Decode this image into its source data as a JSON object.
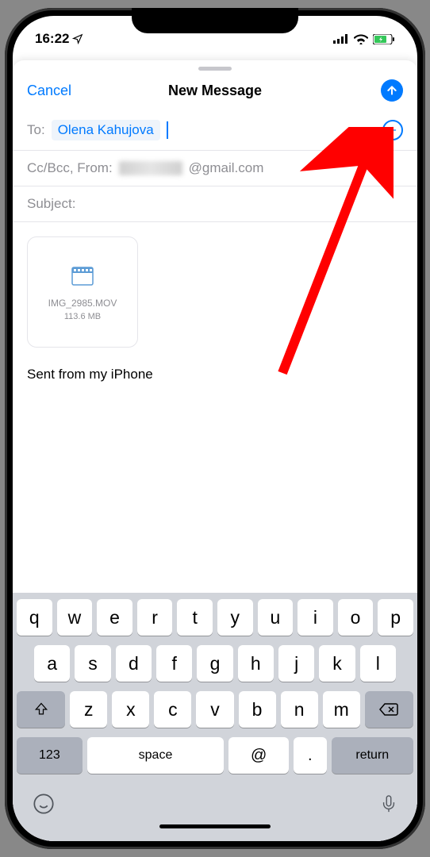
{
  "status": {
    "time": "16:22"
  },
  "nav": {
    "cancel": "Cancel",
    "title": "New Message"
  },
  "to": {
    "label": "To:",
    "recipient": "Olena Kahujova"
  },
  "from": {
    "label": "Cc/Bcc, From:",
    "domain": "@gmail.com"
  },
  "subject": {
    "label": "Subject:"
  },
  "attachment": {
    "name": "IMG_2985.MOV",
    "size": "113.6 MB"
  },
  "body": {
    "signature": "Sent from my iPhone"
  },
  "keyboard": {
    "row1": [
      "q",
      "w",
      "e",
      "r",
      "t",
      "y",
      "u",
      "i",
      "o",
      "p"
    ],
    "row2": [
      "a",
      "s",
      "d",
      "f",
      "g",
      "h",
      "j",
      "k",
      "l"
    ],
    "row3": [
      "z",
      "x",
      "c",
      "v",
      "b",
      "n",
      "m"
    ],
    "numKey": "123",
    "space": "space",
    "at": "@",
    "dot": ".",
    "return": "return"
  }
}
